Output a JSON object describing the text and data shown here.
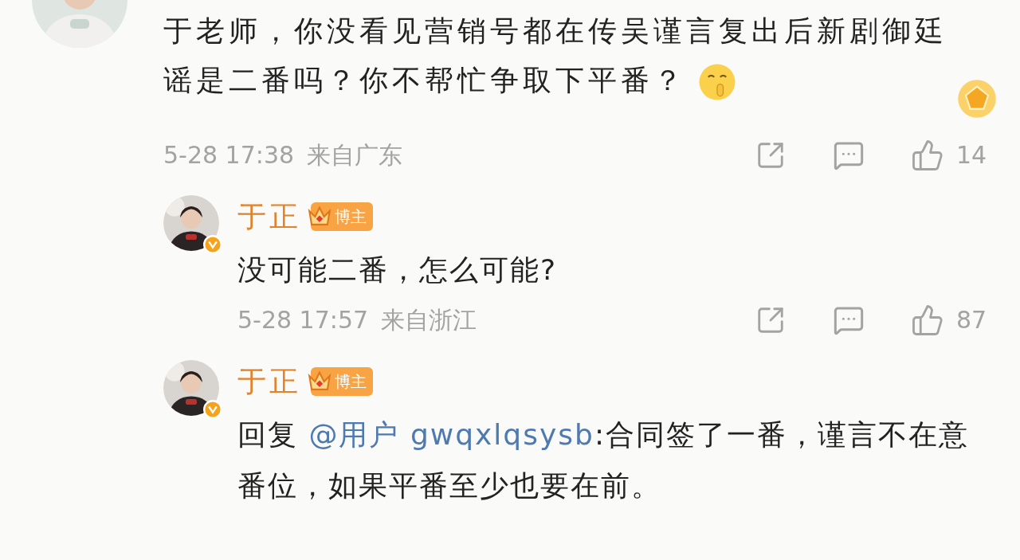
{
  "comment": {
    "text": "于老师，你没看见营销号都在传吴谨言复出后新剧御廷谣是二番吗？你不帮忙争取下平番？",
    "time": "5-28 17:38",
    "location": "来自广东",
    "likes": "14"
  },
  "replies": [
    {
      "author": "于正",
      "badge": "博主",
      "text": "没可能二番，怎么可能?",
      "time": "5-28 17:57",
      "location": "来自浙江",
      "likes": "87"
    },
    {
      "author": "于正",
      "badge": "博主",
      "reply_prefix": "回复",
      "mention": "@用户 gwqxlqsysb",
      "text": ":合同签了一番，谨言不在意番位，如果平番至少也要在前。"
    }
  ]
}
